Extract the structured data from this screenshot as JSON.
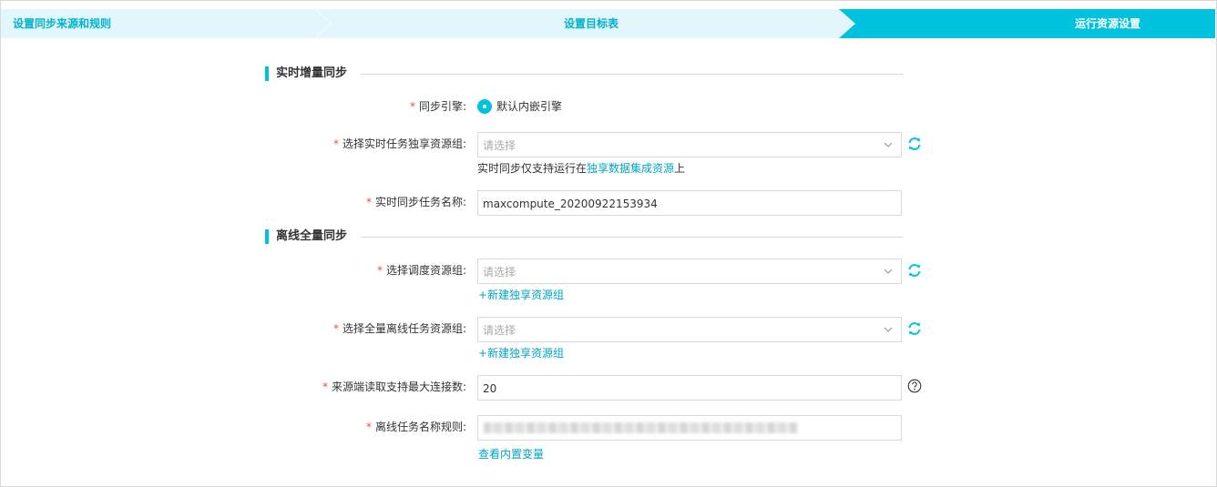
{
  "steps": [
    {
      "label": "设置同步来源和规则"
    },
    {
      "label": "设置目标表"
    },
    {
      "label": "运行资源设置"
    }
  ],
  "sections": {
    "realtime": {
      "title": "实时增量同步"
    },
    "offline": {
      "title": "离线全量同步"
    }
  },
  "realtime": {
    "engine_label": "同步引擎:",
    "engine_option": "默认内嵌引擎",
    "resource_group_label": "选择实时任务独享资源组:",
    "resource_group_placeholder": "请选择",
    "hint_prefix": "实时同步仅支持运行在",
    "hint_link": "独享数据集成资源",
    "hint_suffix": "上",
    "task_name_label": "实时同步任务名称:",
    "task_name_value": "maxcompute_20200922153934"
  },
  "offline": {
    "schedule_group_label": "选择调度资源组:",
    "schedule_group_placeholder": "请选择",
    "new_group_link_1": "+新建独享资源组",
    "full_task_group_label": "选择全量离线任务资源组:",
    "full_task_group_placeholder": "请选择",
    "new_group_link_2": "+新建独享资源组",
    "max_conn_label": "来源端读取支持最大连接数:",
    "max_conn_value": "20",
    "task_name_rule_label": "离线任务名称规则:",
    "view_vars_link": "查看内置变量"
  },
  "required_mark": "*",
  "colors": {
    "accent": "#00c1de",
    "link": "#00a5c3",
    "required": "#e85050",
    "step_inactive_bg": "#e3f6fb"
  },
  "icons": {
    "refresh": "refresh-icon",
    "help": "help-icon",
    "chevron": "chevron-down-icon"
  }
}
